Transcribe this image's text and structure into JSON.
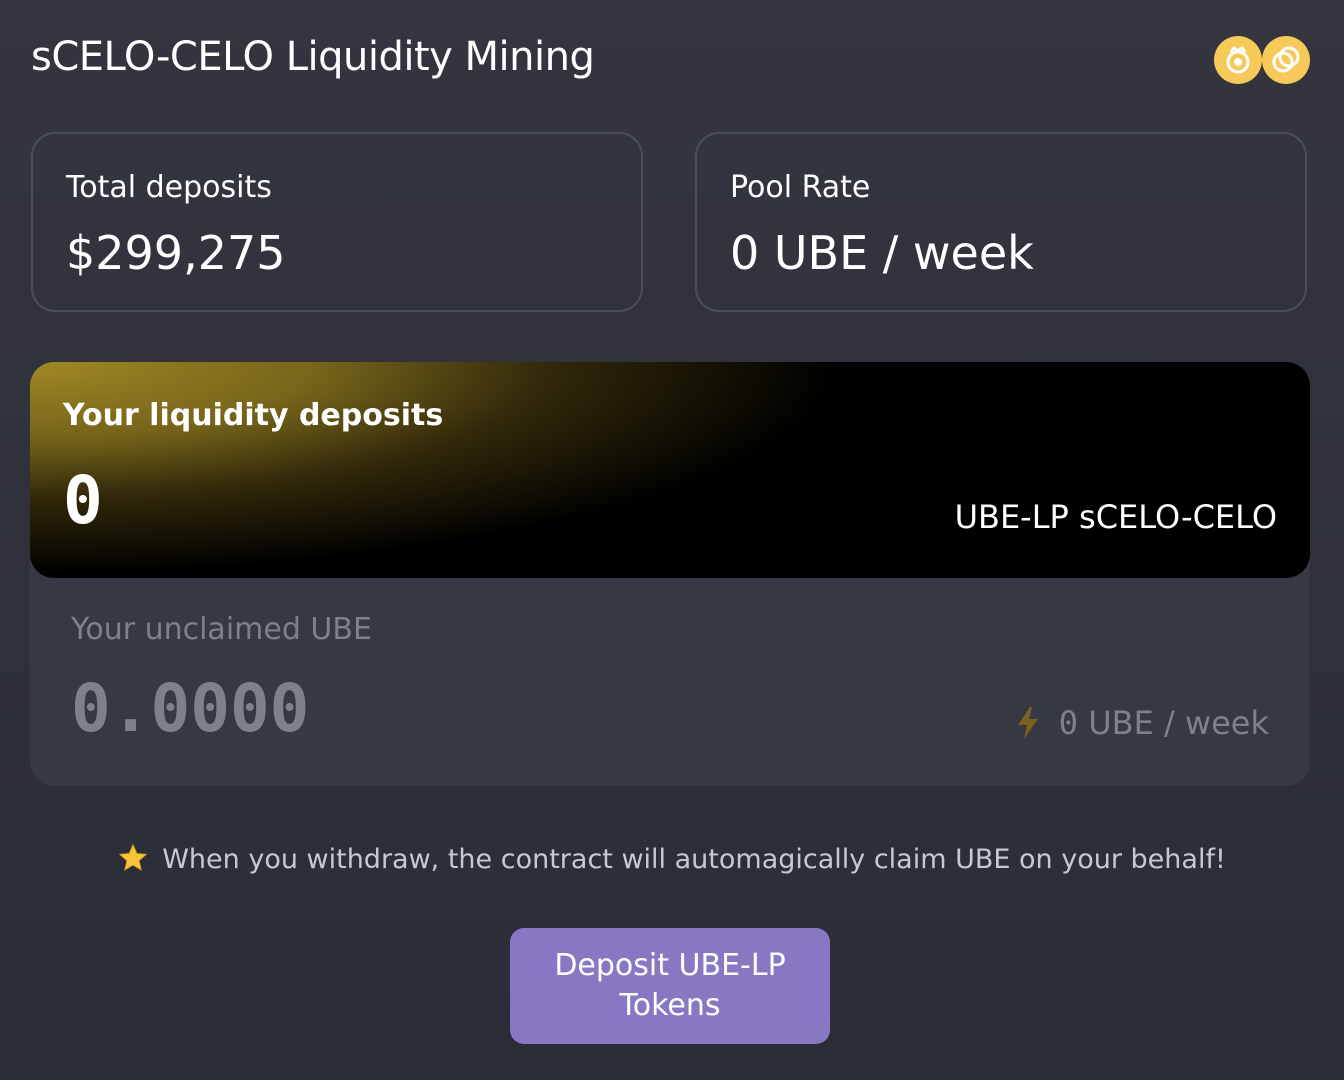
{
  "header": {
    "title": "sCELO-CELO Liquidity Mining",
    "token_icons": [
      "scelo-token-icon",
      "celo-token-icon"
    ],
    "token_icon_color": "#f7c959"
  },
  "stats": {
    "total_deposits": {
      "label": "Total deposits",
      "value": "$299,275"
    },
    "pool_rate": {
      "label": "Pool Rate",
      "value": "0 UBE / week"
    }
  },
  "liquidity": {
    "label": "Your liquidity deposits",
    "value": "0",
    "token": "UBE-LP sCELO-CELO",
    "accent_color": "#a89026"
  },
  "unclaimed": {
    "label": "Your unclaimed UBE",
    "value": "0.0000",
    "rate_icon": "lightning-icon",
    "rate_value": "0",
    "rate_unit": " UBE / week"
  },
  "note": {
    "icon": "star-icon",
    "text": "When you withdraw, the contract will automagically claim UBE on your behalf!"
  },
  "deposit_button": {
    "label": "Deposit UBE-LP Tokens",
    "color": "#8878c3"
  }
}
